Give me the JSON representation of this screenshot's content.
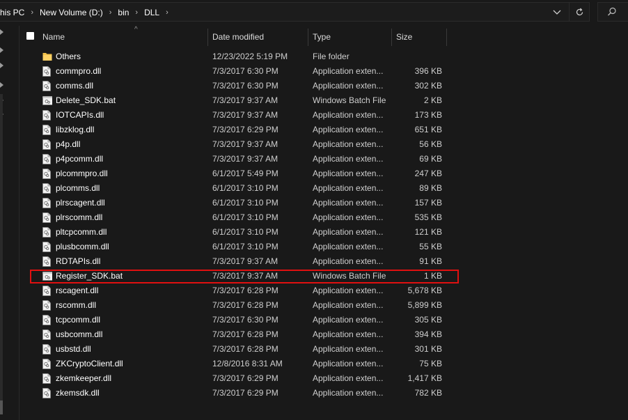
{
  "breadcrumb": {
    "items": [
      "his PC",
      "New Volume (D:)",
      "bin",
      "DLL"
    ],
    "separator": "›"
  },
  "columns": {
    "name": "Name",
    "date": "Date modified",
    "type": "Type",
    "size": "Size"
  },
  "files": [
    {
      "name": "Others",
      "date": "12/23/2022 5:19 PM",
      "type": "File folder",
      "size": "",
      "icon": "folder-icon"
    },
    {
      "name": "commpro.dll",
      "date": "7/3/2017 6:30 PM",
      "type": "Application exten...",
      "size": "396 KB",
      "icon": "dll-file-icon"
    },
    {
      "name": "comms.dll",
      "date": "7/3/2017 6:30 PM",
      "type": "Application exten...",
      "size": "302 KB",
      "icon": "dll-file-icon"
    },
    {
      "name": "Delete_SDK.bat",
      "date": "7/3/2017 9:37 AM",
      "type": "Windows Batch File",
      "size": "2 KB",
      "icon": "batch-file-icon"
    },
    {
      "name": "IOTCAPIs.dll",
      "date": "7/3/2017 9:37 AM",
      "type": "Application exten...",
      "size": "173 KB",
      "icon": "dll-file-icon"
    },
    {
      "name": "libzklog.dll",
      "date": "7/3/2017 6:29 PM",
      "type": "Application exten...",
      "size": "651 KB",
      "icon": "dll-file-icon"
    },
    {
      "name": "p4p.dll",
      "date": "7/3/2017 9:37 AM",
      "type": "Application exten...",
      "size": "56 KB",
      "icon": "dll-file-icon"
    },
    {
      "name": "p4pcomm.dll",
      "date": "7/3/2017 9:37 AM",
      "type": "Application exten...",
      "size": "69 KB",
      "icon": "dll-file-icon"
    },
    {
      "name": "plcommpro.dll",
      "date": "6/1/2017 5:49 PM",
      "type": "Application exten...",
      "size": "247 KB",
      "icon": "dll-file-icon"
    },
    {
      "name": "plcomms.dll",
      "date": "6/1/2017 3:10 PM",
      "type": "Application exten...",
      "size": "89 KB",
      "icon": "dll-file-icon"
    },
    {
      "name": "plrscagent.dll",
      "date": "6/1/2017 3:10 PM",
      "type": "Application exten...",
      "size": "157 KB",
      "icon": "dll-file-icon"
    },
    {
      "name": "plrscomm.dll",
      "date": "6/1/2017 3:10 PM",
      "type": "Application exten...",
      "size": "535 KB",
      "icon": "dll-file-icon"
    },
    {
      "name": "pltcpcomm.dll",
      "date": "6/1/2017 3:10 PM",
      "type": "Application exten...",
      "size": "121 KB",
      "icon": "dll-file-icon"
    },
    {
      "name": "plusbcomm.dll",
      "date": "6/1/2017 3:10 PM",
      "type": "Application exten...",
      "size": "55 KB",
      "icon": "dll-file-icon"
    },
    {
      "name": "RDTAPIs.dll",
      "date": "7/3/2017 9:37 AM",
      "type": "Application exten...",
      "size": "91 KB",
      "icon": "dll-file-icon"
    },
    {
      "name": "Register_SDK.bat",
      "date": "7/3/2017 9:37 AM",
      "type": "Windows Batch File",
      "size": "1 KB",
      "icon": "batch-file-icon"
    },
    {
      "name": "rscagent.dll",
      "date": "7/3/2017 6:28 PM",
      "type": "Application exten...",
      "size": "5,678 KB",
      "icon": "dll-file-icon"
    },
    {
      "name": "rscomm.dll",
      "date": "7/3/2017 6:28 PM",
      "type": "Application exten...",
      "size": "5,899 KB",
      "icon": "dll-file-icon"
    },
    {
      "name": "tcpcomm.dll",
      "date": "7/3/2017 6:30 PM",
      "type": "Application exten...",
      "size": "305 KB",
      "icon": "dll-file-icon"
    },
    {
      "name": "usbcomm.dll",
      "date": "7/3/2017 6:28 PM",
      "type": "Application exten...",
      "size": "394 KB",
      "icon": "dll-file-icon"
    },
    {
      "name": "usbstd.dll",
      "date": "7/3/2017 6:28 PM",
      "type": "Application exten...",
      "size": "301 KB",
      "icon": "dll-file-icon"
    },
    {
      "name": "ZKCryptoClient.dll",
      "date": "12/8/2016 8:31 AM",
      "type": "Application exten...",
      "size": "75 KB",
      "icon": "dll-file-icon"
    },
    {
      "name": "zkemkeeper.dll",
      "date": "7/3/2017 6:29 PM",
      "type": "Application exten...",
      "size": "1,417 KB",
      "icon": "dll-file-icon"
    },
    {
      "name": "zkemsdk.dll",
      "date": "7/3/2017 6:29 PM",
      "type": "Application exten...",
      "size": "782 KB",
      "icon": "dll-file-icon"
    }
  ],
  "highlighted_file": "Register_SDK.bat",
  "colors": {
    "background": "#191919",
    "highlight_border": "#e01010",
    "folder": "#f3c14a"
  }
}
